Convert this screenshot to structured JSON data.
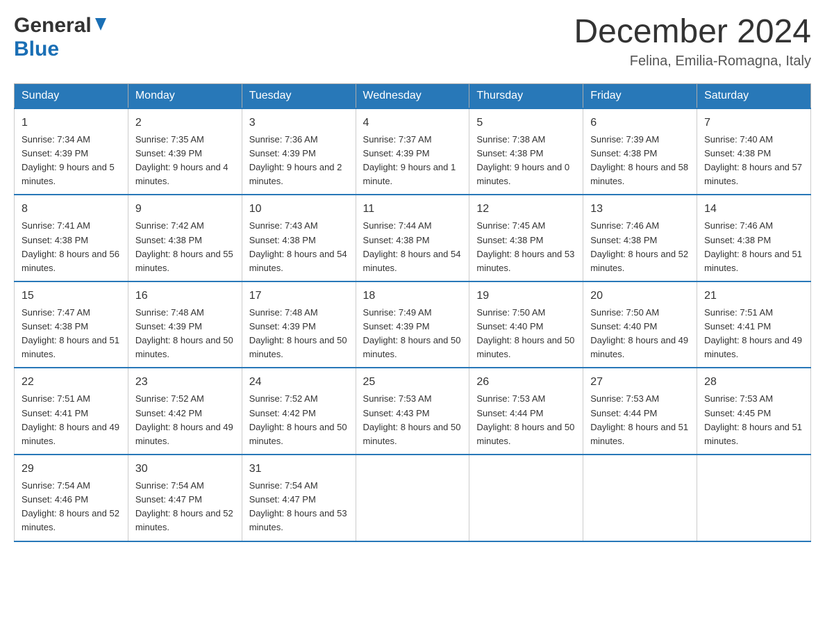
{
  "header": {
    "logo_general": "General",
    "logo_blue": "Blue",
    "title": "December 2024",
    "subtitle": "Felina, Emilia-Romagna, Italy"
  },
  "days_of_week": [
    "Sunday",
    "Monday",
    "Tuesday",
    "Wednesday",
    "Thursday",
    "Friday",
    "Saturday"
  ],
  "weeks": [
    [
      {
        "day": "1",
        "sunrise": "7:34 AM",
        "sunset": "4:39 PM",
        "daylight": "9 hours and 5 minutes."
      },
      {
        "day": "2",
        "sunrise": "7:35 AM",
        "sunset": "4:39 PM",
        "daylight": "9 hours and 4 minutes."
      },
      {
        "day": "3",
        "sunrise": "7:36 AM",
        "sunset": "4:39 PM",
        "daylight": "9 hours and 2 minutes."
      },
      {
        "day": "4",
        "sunrise": "7:37 AM",
        "sunset": "4:39 PM",
        "daylight": "9 hours and 1 minute."
      },
      {
        "day": "5",
        "sunrise": "7:38 AM",
        "sunset": "4:38 PM",
        "daylight": "9 hours and 0 minutes."
      },
      {
        "day": "6",
        "sunrise": "7:39 AM",
        "sunset": "4:38 PM",
        "daylight": "8 hours and 58 minutes."
      },
      {
        "day": "7",
        "sunrise": "7:40 AM",
        "sunset": "4:38 PM",
        "daylight": "8 hours and 57 minutes."
      }
    ],
    [
      {
        "day": "8",
        "sunrise": "7:41 AM",
        "sunset": "4:38 PM",
        "daylight": "8 hours and 56 minutes."
      },
      {
        "day": "9",
        "sunrise": "7:42 AM",
        "sunset": "4:38 PM",
        "daylight": "8 hours and 55 minutes."
      },
      {
        "day": "10",
        "sunrise": "7:43 AM",
        "sunset": "4:38 PM",
        "daylight": "8 hours and 54 minutes."
      },
      {
        "day": "11",
        "sunrise": "7:44 AM",
        "sunset": "4:38 PM",
        "daylight": "8 hours and 54 minutes."
      },
      {
        "day": "12",
        "sunrise": "7:45 AM",
        "sunset": "4:38 PM",
        "daylight": "8 hours and 53 minutes."
      },
      {
        "day": "13",
        "sunrise": "7:46 AM",
        "sunset": "4:38 PM",
        "daylight": "8 hours and 52 minutes."
      },
      {
        "day": "14",
        "sunrise": "7:46 AM",
        "sunset": "4:38 PM",
        "daylight": "8 hours and 51 minutes."
      }
    ],
    [
      {
        "day": "15",
        "sunrise": "7:47 AM",
        "sunset": "4:38 PM",
        "daylight": "8 hours and 51 minutes."
      },
      {
        "day": "16",
        "sunrise": "7:48 AM",
        "sunset": "4:39 PM",
        "daylight": "8 hours and 50 minutes."
      },
      {
        "day": "17",
        "sunrise": "7:48 AM",
        "sunset": "4:39 PM",
        "daylight": "8 hours and 50 minutes."
      },
      {
        "day": "18",
        "sunrise": "7:49 AM",
        "sunset": "4:39 PM",
        "daylight": "8 hours and 50 minutes."
      },
      {
        "day": "19",
        "sunrise": "7:50 AM",
        "sunset": "4:40 PM",
        "daylight": "8 hours and 50 minutes."
      },
      {
        "day": "20",
        "sunrise": "7:50 AM",
        "sunset": "4:40 PM",
        "daylight": "8 hours and 49 minutes."
      },
      {
        "day": "21",
        "sunrise": "7:51 AM",
        "sunset": "4:41 PM",
        "daylight": "8 hours and 49 minutes."
      }
    ],
    [
      {
        "day": "22",
        "sunrise": "7:51 AM",
        "sunset": "4:41 PM",
        "daylight": "8 hours and 49 minutes."
      },
      {
        "day": "23",
        "sunrise": "7:52 AM",
        "sunset": "4:42 PM",
        "daylight": "8 hours and 49 minutes."
      },
      {
        "day": "24",
        "sunrise": "7:52 AM",
        "sunset": "4:42 PM",
        "daylight": "8 hours and 50 minutes."
      },
      {
        "day": "25",
        "sunrise": "7:53 AM",
        "sunset": "4:43 PM",
        "daylight": "8 hours and 50 minutes."
      },
      {
        "day": "26",
        "sunrise": "7:53 AM",
        "sunset": "4:44 PM",
        "daylight": "8 hours and 50 minutes."
      },
      {
        "day": "27",
        "sunrise": "7:53 AM",
        "sunset": "4:44 PM",
        "daylight": "8 hours and 51 minutes."
      },
      {
        "day": "28",
        "sunrise": "7:53 AM",
        "sunset": "4:45 PM",
        "daylight": "8 hours and 51 minutes."
      }
    ],
    [
      {
        "day": "29",
        "sunrise": "7:54 AM",
        "sunset": "4:46 PM",
        "daylight": "8 hours and 52 minutes."
      },
      {
        "day": "30",
        "sunrise": "7:54 AM",
        "sunset": "4:47 PM",
        "daylight": "8 hours and 52 minutes."
      },
      {
        "day": "31",
        "sunrise": "7:54 AM",
        "sunset": "4:47 PM",
        "daylight": "8 hours and 53 minutes."
      },
      null,
      null,
      null,
      null
    ]
  ],
  "labels": {
    "sunrise": "Sunrise:",
    "sunset": "Sunset:",
    "daylight": "Daylight:"
  },
  "colors": {
    "header_bg": "#2878b8",
    "header_text": "#ffffff",
    "border": "#2878b8"
  }
}
